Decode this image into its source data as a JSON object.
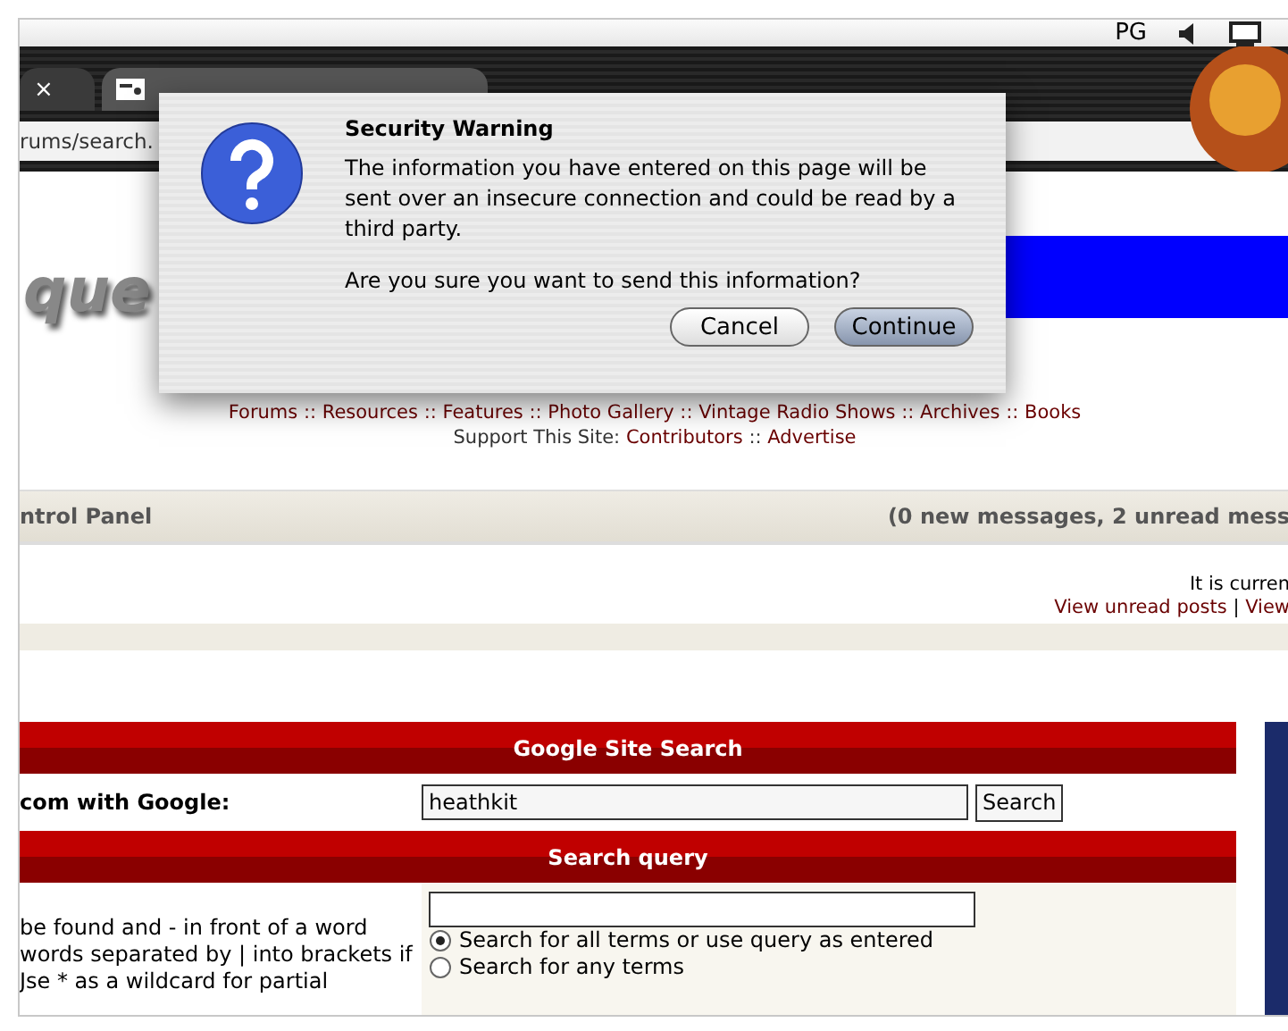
{
  "menubar": {
    "items": [
      "PG"
    ]
  },
  "browser": {
    "tabs": [
      {
        "close": "×",
        "selected": false
      },
      {
        "selected": true
      }
    ],
    "url": "rums/search."
  },
  "page": {
    "logo": "que",
    "nav": [
      "Forums :: Resources :: Features :: Photo Gallery :: Vintage Radio Shows :: Archives :: Books"
    ],
    "support": {
      "label": "Support This Site:",
      "links": [
        "Contributors",
        "Advertise"
      ],
      "separator": "::"
    },
    "control_panel": {
      "title": "ntrol Panel",
      "messages": "(0 new messages, 2 unread mess"
    },
    "info": {
      "text": "It is curren",
      "links": [
        "View unread posts",
        "View"
      ],
      "separator": "|"
    },
    "google": {
      "header": "Google Site Search",
      "label": "com with Google:",
      "value": "heathkit",
      "button": "Search"
    },
    "query": {
      "header": "Search query",
      "help": [
        "be found and - in front of a word",
        "words separated by | into brackets if",
        "Jse * as a wildcard for partial"
      ],
      "options": [
        {
          "label": "Search for all terms or use query as entered",
          "selected": true
        },
        {
          "label": "Search for any terms",
          "selected": false
        }
      ]
    }
  },
  "dialog": {
    "title": "Security Warning",
    "message": "The information you have entered on this page will be sent over an insecure connection and could be read by a third party.",
    "question": "Are you sure you want to send this information?",
    "buttons": [
      {
        "label": "Cancel",
        "kind": "secondary"
      },
      {
        "label": "Continue",
        "kind": "default"
      }
    ]
  }
}
